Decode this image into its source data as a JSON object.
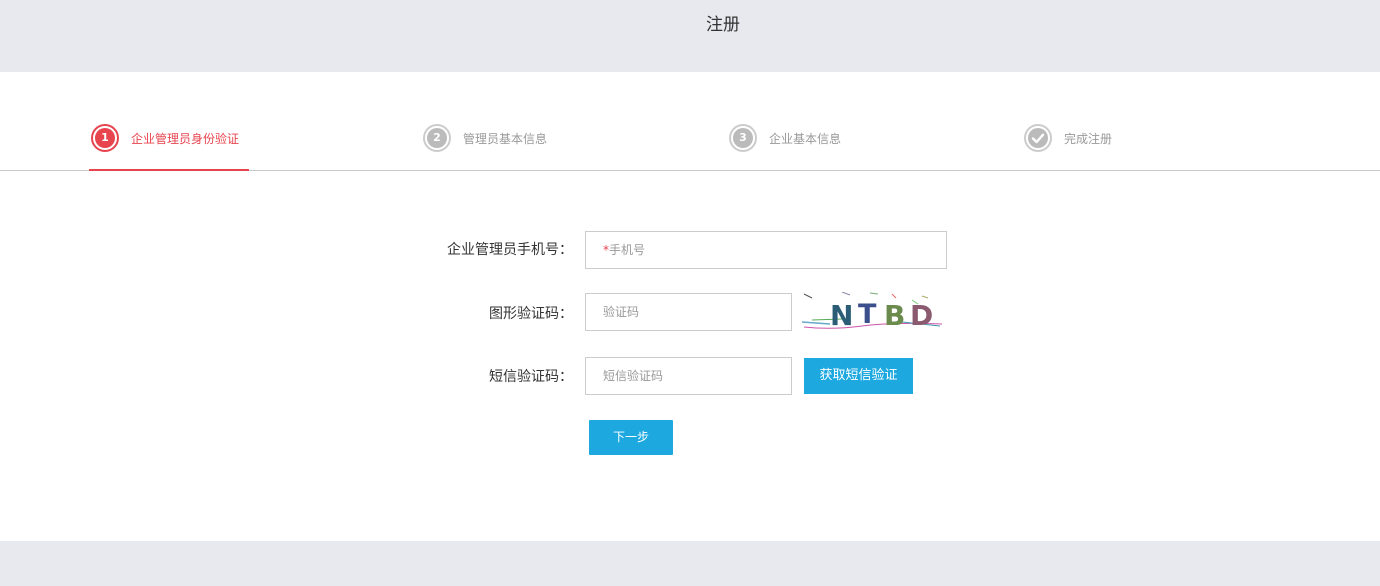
{
  "header": {
    "title": "注册"
  },
  "steps": [
    {
      "number": "1",
      "label": "企业管理员身份验证",
      "state": "active"
    },
    {
      "number": "2",
      "label": "管理员基本信息",
      "state": "pending"
    },
    {
      "number": "3",
      "label": "企业基本信息",
      "state": "pending"
    },
    {
      "number": "check-icon",
      "label": "完成注册",
      "state": "pending"
    }
  ],
  "form": {
    "phone_label": "企业管理员手机号：",
    "phone_required_mark": "*",
    "phone_placeholder": "手机号",
    "captcha_label": "图形验证码：",
    "captcha_placeholder": "验证码",
    "captcha_text": "NTBD",
    "sms_label": "短信验证码：",
    "sms_placeholder": "短信验证码",
    "sms_button": "获取短信验证",
    "next_button": "下一步"
  },
  "colors": {
    "accent_red": "#e8444e",
    "button_blue": "#1da9e0",
    "background_gray": "#e8e9ee"
  }
}
